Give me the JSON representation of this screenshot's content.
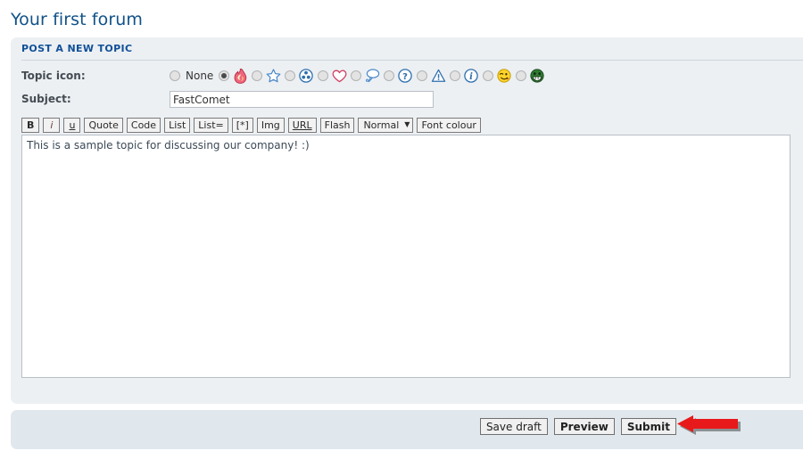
{
  "page": {
    "title": "Your first forum"
  },
  "panel": {
    "heading": "POST A NEW TOPIC"
  },
  "form": {
    "topic_icon_label": "Topic icon:",
    "subject_label": "Subject:",
    "subject_value": "FastComet",
    "subject_placeholder": "",
    "icons": [
      {
        "name": "none",
        "label": "None",
        "glyph": "none",
        "selected": false
      },
      {
        "name": "flame",
        "label": "",
        "glyph": "flame",
        "selected": true
      },
      {
        "name": "star",
        "label": "",
        "glyph": "star",
        "selected": false
      },
      {
        "name": "radioactive",
        "label": "",
        "glyph": "radioactive",
        "selected": false
      },
      {
        "name": "heart",
        "label": "",
        "glyph": "heart",
        "selected": false
      },
      {
        "name": "thought-bubble",
        "label": "",
        "glyph": "bubble",
        "selected": false
      },
      {
        "name": "question",
        "label": "",
        "glyph": "question",
        "selected": false
      },
      {
        "name": "warning",
        "label": "",
        "glyph": "warning",
        "selected": false
      },
      {
        "name": "info",
        "label": "",
        "glyph": "info",
        "selected": false
      },
      {
        "name": "smiley-yellow",
        "label": "",
        "glyph": "smiley",
        "selected": false
      },
      {
        "name": "smiley-green",
        "label": "",
        "glyph": "grin",
        "selected": false
      }
    ]
  },
  "editor": {
    "toolbar": [
      {
        "id": "bold",
        "label": "B",
        "style": "bold"
      },
      {
        "id": "italic",
        "label": "i",
        "style": "italic"
      },
      {
        "id": "underline",
        "label": "u",
        "style": "under"
      },
      {
        "id": "quote",
        "label": "Quote",
        "style": ""
      },
      {
        "id": "code",
        "label": "Code",
        "style": ""
      },
      {
        "id": "list",
        "label": "List",
        "style": ""
      },
      {
        "id": "list-ordered",
        "label": "List=",
        "style": ""
      },
      {
        "id": "list-item",
        "label": "[*]",
        "style": ""
      },
      {
        "id": "img",
        "label": "Img",
        "style": ""
      },
      {
        "id": "url",
        "label": "URL",
        "style": "url"
      },
      {
        "id": "flash",
        "label": "Flash",
        "style": ""
      }
    ],
    "font_size_selected": "Normal",
    "font_size_options": [
      "Normal"
    ],
    "font_colour_label": "Font colour",
    "body_value": "This is a sample topic for discussing our company! :)",
    "body_placeholder": ""
  },
  "footer": {
    "buttons": [
      {
        "id": "save-draft",
        "label": "Save draft",
        "strong": false
      },
      {
        "id": "preview",
        "label": "Preview",
        "strong": true
      },
      {
        "id": "submit",
        "label": "Submit",
        "strong": true
      }
    ]
  },
  "annotation": {
    "arrow_color": "#e8191b",
    "arrow_direction": "left",
    "points_at": "submit"
  },
  "colors": {
    "title": "#105289",
    "heading": "#115098",
    "panel_bg": "#ecf0f3",
    "footer_bg": "#e1e8ed",
    "input_border": "#b8bfc6"
  }
}
